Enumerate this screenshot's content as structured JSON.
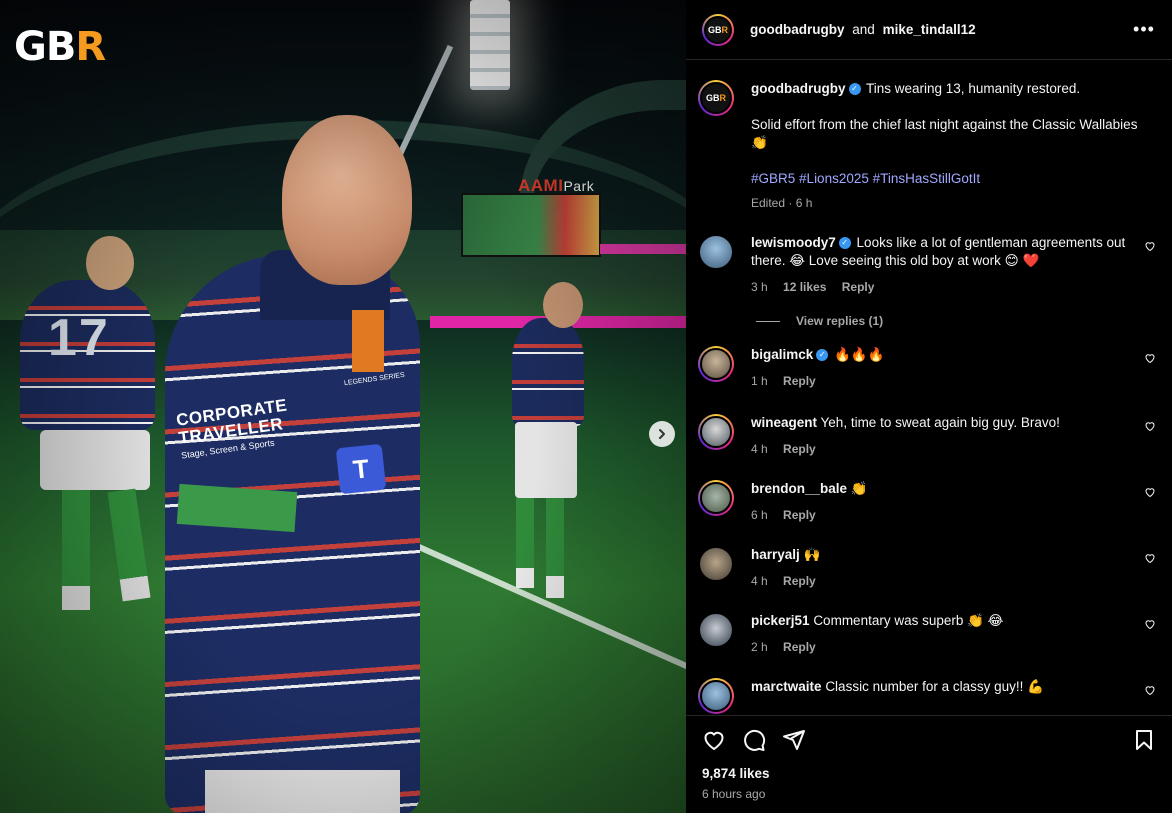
{
  "brand": {
    "logo_main": "GB",
    "logo_accent": "R"
  },
  "header": {
    "user1": "goodbadrugby",
    "joiner": "and",
    "user2": "mike_tindall12",
    "more_label": "•••"
  },
  "caption": {
    "username": "goodbadrugby",
    "verified": true,
    "line1": "Tins wearing 13, humanity restored.",
    "line2": "Solid effort from the chief last night against the Classic Wallabies 👏",
    "hashtags": [
      "#GBR5",
      "#Lions2025",
      "#TinsHasStillGotIt"
    ],
    "meta": "Edited · 6 h"
  },
  "comments": [
    {
      "username": "lewismoody7",
      "verified": true,
      "text": "Looks like a lot of gentleman agreements out there. 😂 Love seeing this old boy at work 😊 ❤️",
      "time": "3 h",
      "likes": "12 likes",
      "reply": "Reply",
      "view_replies": "View replies (1)"
    },
    {
      "username": "bigalimck",
      "verified": true,
      "text": "🔥🔥🔥",
      "time": "1 h",
      "reply": "Reply"
    },
    {
      "username": "wineagent",
      "verified": false,
      "text": "Yeh, time to sweat again big guy. Bravo!",
      "time": "4 h",
      "reply": "Reply"
    },
    {
      "username": "brendon__bale",
      "verified": false,
      "text": "👏",
      "time": "6 h",
      "reply": "Reply"
    },
    {
      "username": "harryalj",
      "verified": false,
      "text": "🙌",
      "time": "4 h",
      "reply": "Reply"
    },
    {
      "username": "pickerj51",
      "verified": false,
      "text": "Commentary was superb 👏 😂",
      "time": "2 h",
      "reply": "Reply"
    },
    {
      "username": "marctwaite",
      "verified": false,
      "text": "Classic number for a classy guy!! 💪",
      "time": "",
      "reply": ""
    }
  ],
  "post": {
    "likes": "9,874 likes",
    "time": "6 hours ago"
  },
  "photo": {
    "sponsor_line1": "CORPORATE",
    "sponsor_line2": "TRAVELLER",
    "sponsor_sub": "Stage, Screen & Sports",
    "legends": "LEGENDS SERIES",
    "jersey_number": "17",
    "stadium_sign": "AAMI",
    "stadium_sign2": "Park",
    "t_logo": "T"
  },
  "icons": {
    "like": "heart-icon",
    "comment": "comment-icon",
    "share": "send-icon",
    "save": "bookmark-icon",
    "next": "chevron-right-icon",
    "more": "more-horizontal-icon"
  },
  "colors": {
    "accent_orange": "#f39a1f",
    "hashtag": "#a0a8ff",
    "verified": "#3897f0",
    "muted": "#a8a8a8"
  }
}
